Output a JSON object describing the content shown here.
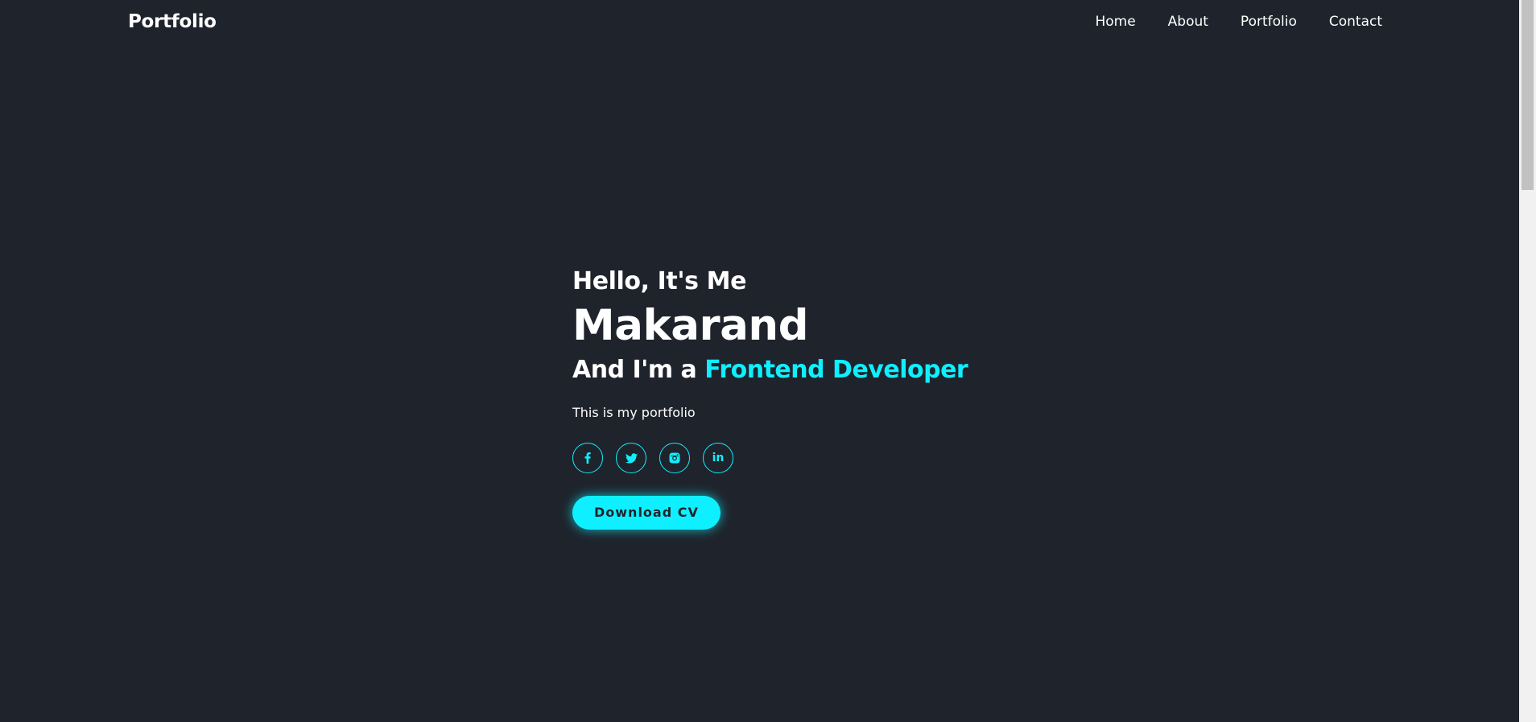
{
  "header": {
    "logo": "Portfolio",
    "nav": [
      {
        "label": "Home"
      },
      {
        "label": "About"
      },
      {
        "label": "Portfolio"
      },
      {
        "label": "Contact"
      }
    ]
  },
  "hero": {
    "greeting": "Hello, It's Me",
    "name": "Makarand",
    "role_prefix": "And I'm a",
    "role_highlight": "Frontend Developer",
    "tagline": "This is my portfolio",
    "socials": [
      {
        "icon": "facebook-icon"
      },
      {
        "icon": "twitter-icon"
      },
      {
        "icon": "instagram-icon"
      },
      {
        "icon": "linkedin-icon",
        "glyph": "in"
      }
    ],
    "cta_label": "Download CV"
  },
  "colors": {
    "background": "#1f232c",
    "accent": "#0ef0ff",
    "text": "#ffffff"
  }
}
